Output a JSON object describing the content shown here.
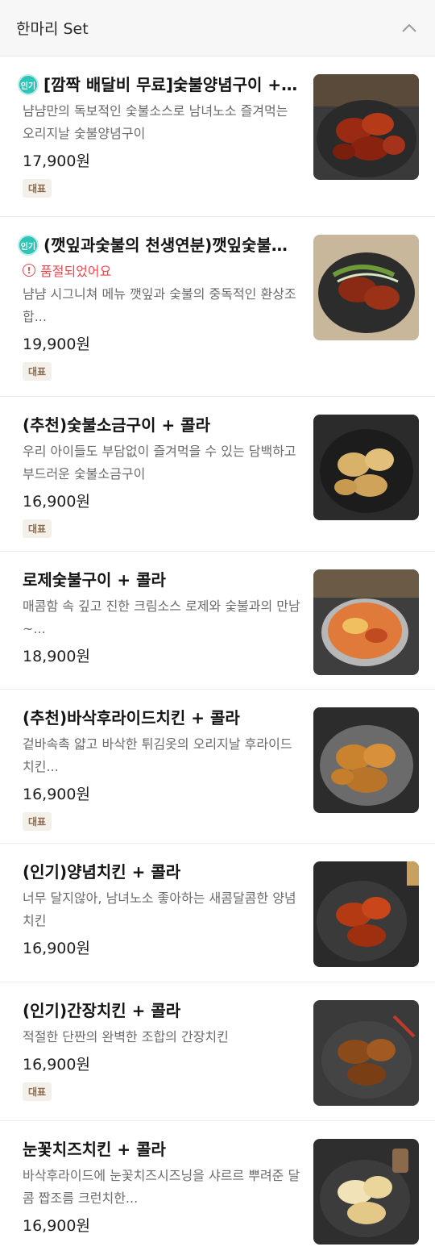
{
  "section": {
    "title": "한마리 Set",
    "collapse_icon": "chevron-up-icon"
  },
  "colors": {
    "accent_teal": "#2ec4b6",
    "soldout_red": "#e8484d",
    "badge_bg": "#f3efe9",
    "badge_text": "#8a6a4b"
  },
  "items": [
    {
      "name": "[깜짝 배달비 무료]숯불양념구이 +…",
      "popular_label": "인기",
      "desc": "냠냠만의 독보적인 숯불소스로 남녀노소 즐겨먹는 오리지날 숯불양념구이",
      "price": "17,900원",
      "badge": "대표",
      "image": "spicy-grilled-chicken-image"
    },
    {
      "name": "(깻잎과숯불의 천생연분)깻잎숯불…",
      "popular_label": "인기",
      "soldout": "품절되었어요",
      "desc": "냠냠 시그니쳐 메뉴 깻잎과 숯불의 중독적인 환상조합...",
      "price": "19,900원",
      "badge": "대표",
      "image": "perilla-chicken-image"
    },
    {
      "name": "(추천)숯불소금구이 + 콜라",
      "desc": "우리 아이들도 부담없이 즐겨먹을 수 있는 담백하고 부드러운 숯불소금구이",
      "price": "16,900원",
      "badge": "대표",
      "image": "salt-grilled-chicken-image"
    },
    {
      "name": "로제숯불구이 + 콜라",
      "desc": "매콤함 속 깊고 진한 크림소스 로제와 숯불과의 만남~...",
      "price": "18,900원",
      "image": "rose-grilled-chicken-image"
    },
    {
      "name": "(추천)바삭후라이드치킨 + 콜라",
      "desc": "겉바속촉 얇고 바삭한 튀김옷의 오리지날 후라이드치킨...",
      "price": "16,900원",
      "badge": "대표",
      "image": "fried-chicken-image"
    },
    {
      "name": "(인기)양념치킨 + 콜라",
      "desc": "너무 달지않아, 남녀노소 좋아하는 새콤달콤한 양념치킨",
      "price": "16,900원",
      "image": "yangnyeom-chicken-image"
    },
    {
      "name": "(인기)간장치킨 + 콜라",
      "desc": "적절한 단짠의 완벽한 조합의 간장치킨",
      "price": "16,900원",
      "badge": "대표",
      "image": "soy-chicken-image"
    },
    {
      "name": "눈꽃치즈치킨 + 콜라",
      "desc": "바삭후라이드에 눈꽃치즈시즈닝을 샤르르 뿌려준 달콤 짭조름 크런치한...",
      "price": "16,900원",
      "image": "snow-cheese-chicken-image"
    }
  ]
}
